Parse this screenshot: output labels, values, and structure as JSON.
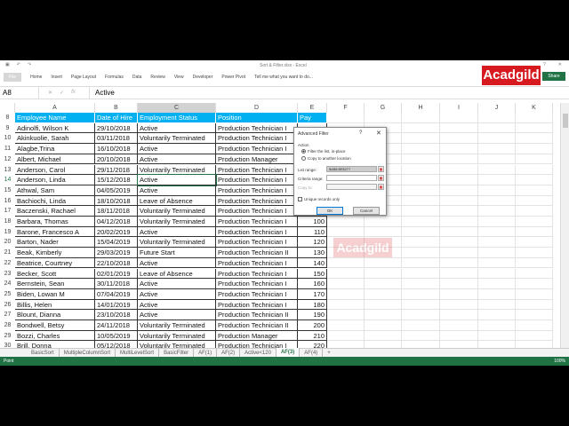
{
  "window": {
    "title": "Sort & Filter.xlsx - Excel",
    "help": "?",
    "close": "✕",
    "minimize": "—"
  },
  "ribbon": {
    "tabs": [
      "File",
      "Home",
      "Insert",
      "Page Layout",
      "Formulas",
      "Data",
      "Review",
      "View",
      "Developer",
      "Power Pivot"
    ],
    "tell_me": "Tell me what you want to do...",
    "share": "Share"
  },
  "logo": "Acadgild",
  "formula_bar": {
    "name_box": "A8",
    "value": "Active"
  },
  "columns": [
    "A",
    "B",
    "C",
    "D",
    "E",
    "F",
    "G",
    "H",
    "I",
    "J",
    "K"
  ],
  "table": {
    "header_row": 8,
    "headers": [
      "Employee Name",
      "Date of Hire",
      "Employment Status",
      "Position",
      "Pay"
    ],
    "rows": [
      {
        "n": 9,
        "cells": [
          "Adinolfi, Wilson  K",
          "29/10/2018",
          "Active",
          "Production Technician I",
          ""
        ]
      },
      {
        "n": 10,
        "cells": [
          "Akinkuolie, Sarah",
          "03/11/2018",
          "Voluntarily Terminated",
          "Production Technician I",
          ""
        ]
      },
      {
        "n": 11,
        "cells": [
          "Alagbe,Trina",
          "16/10/2018",
          "Active",
          "Production Technician I",
          ""
        ]
      },
      {
        "n": 12,
        "cells": [
          "Albert, Michael",
          "20/10/2018",
          "Active",
          "Production Manager",
          ""
        ]
      },
      {
        "n": 13,
        "cells": [
          "Anderson, Carol",
          "29/11/2018",
          "Voluntarily Terminated",
          "Production Technician I",
          ""
        ]
      },
      {
        "n": 14,
        "cells": [
          "Anderson, Linda",
          "15/12/2018",
          "Active",
          "Production Technician I",
          ""
        ]
      },
      {
        "n": 15,
        "cells": [
          "Athwal, Sam",
          "04/05/2019",
          "Active",
          "Production Technician I",
          ""
        ]
      },
      {
        "n": 16,
        "cells": [
          "Bachiochi, Linda",
          "18/10/2018",
          "Leave of Absence",
          "Production Technician I",
          ""
        ]
      },
      {
        "n": 17,
        "cells": [
          "Baczenski, Rachael",
          "18/11/2018",
          "Voluntarily Terminated",
          "Production Technician I",
          ""
        ]
      },
      {
        "n": 18,
        "cells": [
          "Barbara, Thomas",
          "04/12/2018",
          "Voluntarily Terminated",
          "Production Technician I",
          "100"
        ]
      },
      {
        "n": 19,
        "cells": [
          "Barone, Francesco  A",
          "20/02/2019",
          "Active",
          "Production Technician I",
          "110"
        ]
      },
      {
        "n": 20,
        "cells": [
          "Barton, Nader",
          "15/04/2019",
          "Voluntarily Terminated",
          "Production Technician I",
          "120"
        ]
      },
      {
        "n": 21,
        "cells": [
          "Beak, Kimberly",
          "29/03/2019",
          "Future Start",
          "Production Technician II",
          "130"
        ]
      },
      {
        "n": 22,
        "cells": [
          "Beatrice, Courtney",
          "22/10/2018",
          "Active",
          "Production Technician I",
          "140"
        ]
      },
      {
        "n": 23,
        "cells": [
          "Becker, Scott",
          "02/01/2019",
          "Leave of Absence",
          "Production Technician I",
          "150"
        ]
      },
      {
        "n": 24,
        "cells": [
          "Bernstein, Sean",
          "30/11/2018",
          "Active",
          "Production Technician I",
          "160"
        ]
      },
      {
        "n": 25,
        "cells": [
          "Biden, Lowan  M",
          "07/04/2019",
          "Active",
          "Production Technician I",
          "170"
        ]
      },
      {
        "n": 26,
        "cells": [
          "Billis, Helen",
          "14/01/2019",
          "Active",
          "Production Technician I",
          "180"
        ]
      },
      {
        "n": 27,
        "cells": [
          "Blount, Dianna",
          "23/10/2018",
          "Active",
          "Production Technician II",
          "190"
        ]
      },
      {
        "n": 28,
        "cells": [
          "Bondwell, Betsy",
          "24/11/2018",
          "Voluntarily Terminated",
          "Production Technician II",
          "200"
        ]
      },
      {
        "n": 29,
        "cells": [
          "Bozzi, Charles",
          "10/05/2019",
          "Voluntarily Terminated",
          "Production Manager",
          "210"
        ]
      },
      {
        "n": 30,
        "cells": [
          "Brill, Donna",
          "05/12/2018",
          "Voluntarily Terminated",
          "Production Technician I",
          "220"
        ]
      }
    ]
  },
  "dialog": {
    "title": "Advanced Filter",
    "help": "?",
    "close": "✕",
    "action_label": "Action",
    "option1": "Filter the list, in-place",
    "option2": "Copy to another location",
    "list_range_label": "List range:",
    "list_range_value": "$A$8:$E$277",
    "criteria_label": "Criteria range:",
    "copy_to_label": "Copy to:",
    "unique_label": "Unique records only",
    "ok": "OK",
    "cancel": "Cancel"
  },
  "sheets": {
    "tabs": [
      "BasicSort",
      "MultipleColumnSort",
      "MultiLevelSort",
      "BasicFilter",
      "AF(1)",
      "AF(2)",
      "Active<120",
      "AF(3)",
      "AF(4)"
    ],
    "active": "AF(3)",
    "add": "+"
  },
  "status": {
    "mode": "Point",
    "zoom": "100%"
  },
  "colors": {
    "header_fill": "#00b0f0",
    "excel_green": "#217346",
    "logo_red": "#d71920"
  }
}
